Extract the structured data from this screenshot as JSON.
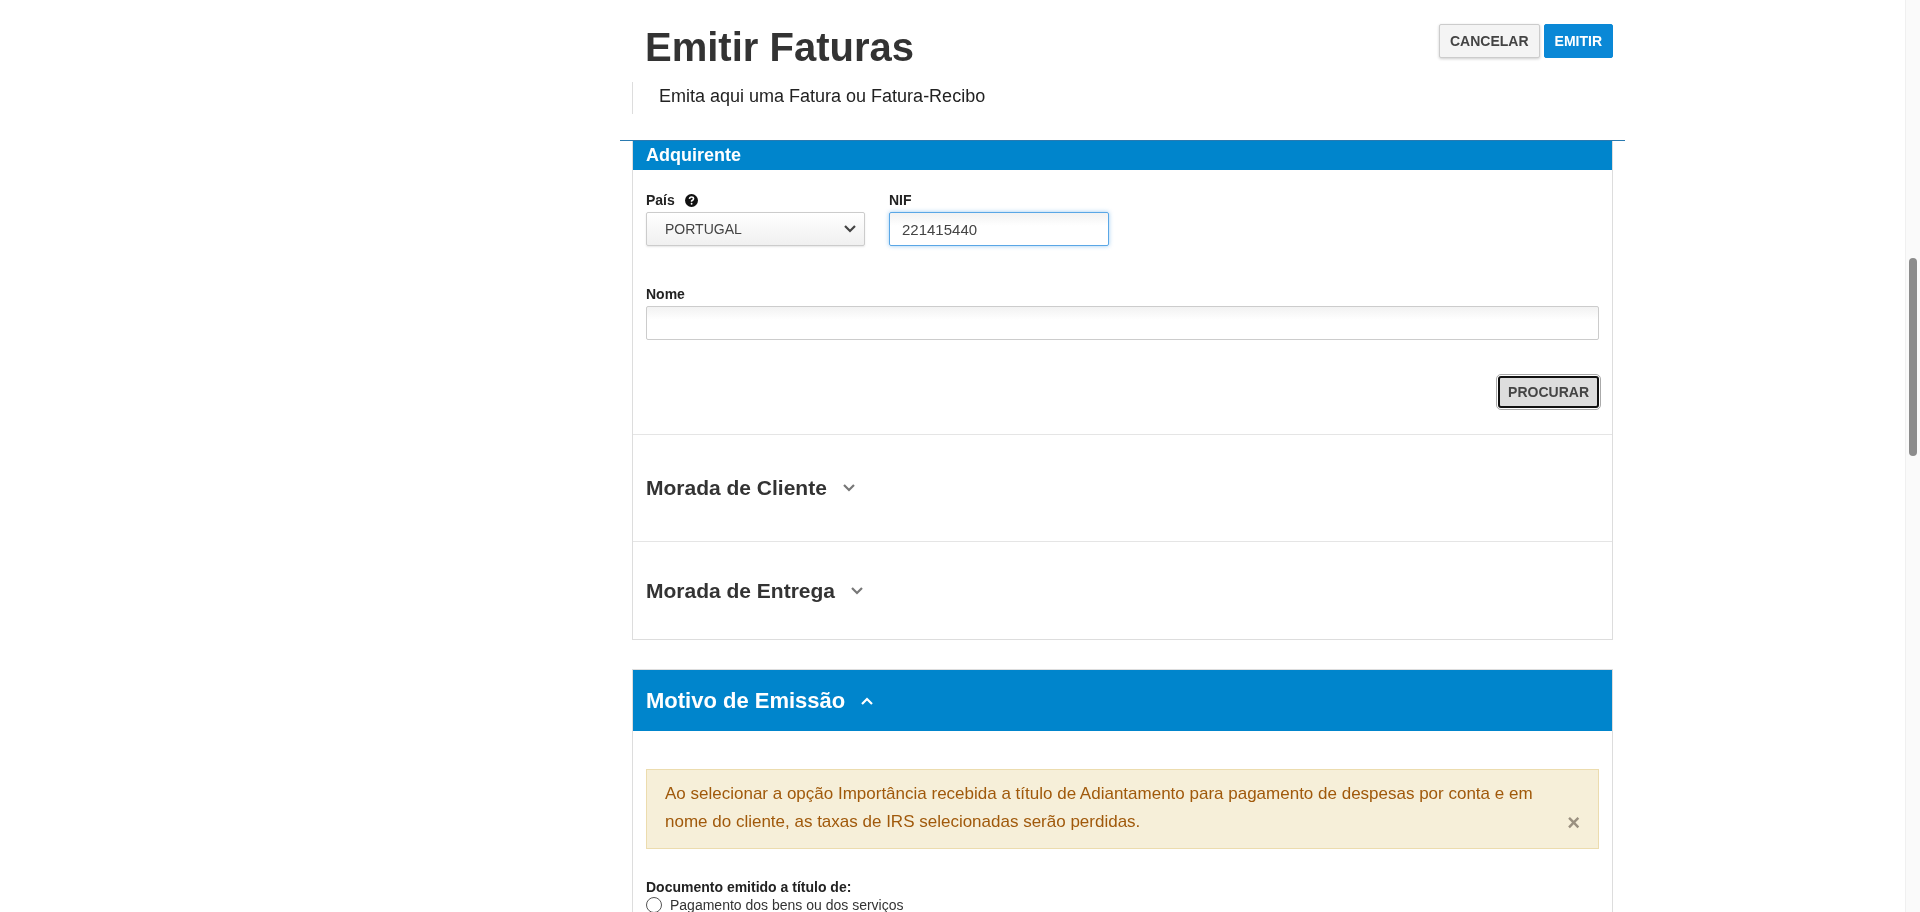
{
  "header": {
    "title": "Emitir Faturas",
    "subtitle": "Emita aqui uma Fatura ou Fatura-Recibo",
    "buttons": [
      {
        "label": "CANCELAR",
        "kind": "secondary"
      },
      {
        "label": "EMITIR",
        "kind": "primary"
      }
    ]
  },
  "adquirente": {
    "title": "Adquirente",
    "pais": {
      "label": "País",
      "value": "PORTUGAL"
    },
    "nif": {
      "label": "NIF",
      "value": "221415440"
    },
    "nome": {
      "label": "Nome"
    },
    "search_button": "PROCURAR",
    "sections": [
      {
        "title": "Morada de Cliente",
        "expanded": false
      },
      {
        "title": "Morada de Entrega",
        "expanded": false
      }
    ]
  },
  "motivo": {
    "title": "Motivo de Emissão",
    "expanded": true,
    "alert": "Ao selecionar a opção Importância recebida a título de Adiantamento para pagamento de despesas por conta e em nome do cliente, as taxas de IRS selecionadas serão perdidas.",
    "alert_close": "×",
    "question": "Documento emitido a título de:",
    "options": [
      {
        "label": "Pagamento dos bens ou dos serviços",
        "selected": false
      }
    ]
  }
}
